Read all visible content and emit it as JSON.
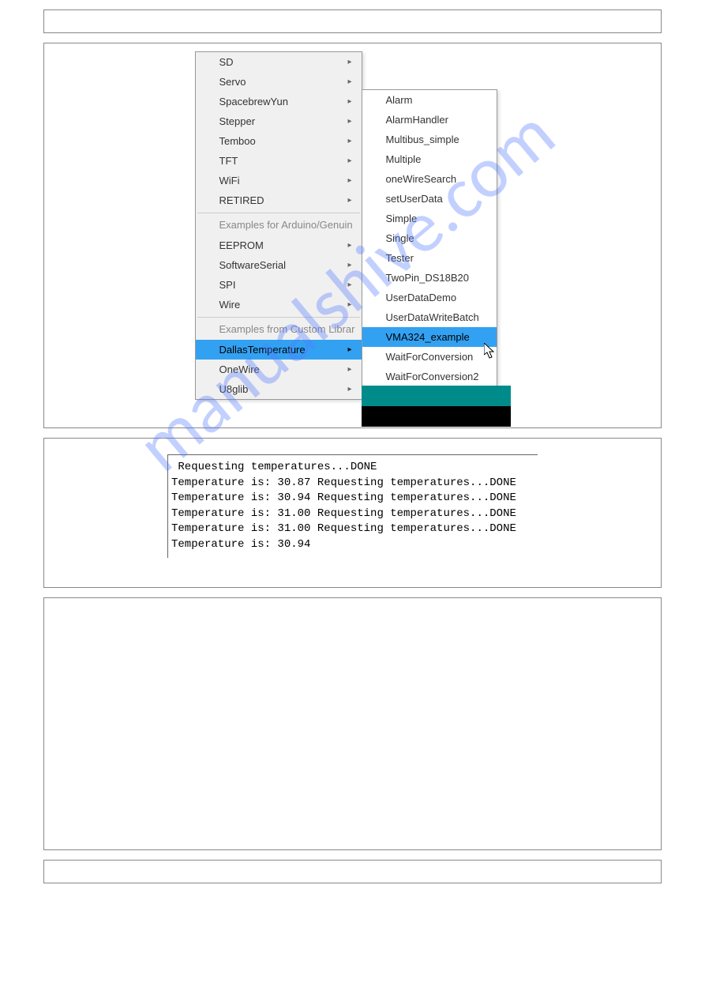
{
  "left_menu": {
    "group1": [
      "SD",
      "Servo",
      "SpacebrewYun",
      "Stepper",
      "Temboo",
      "TFT",
      "WiFi",
      "RETIRED"
    ],
    "header2": "Examples for Arduino/Genuin",
    "group2": [
      "EEPROM",
      "SoftwareSerial",
      "SPI",
      "Wire"
    ],
    "header3": "Examples from Custom Librar",
    "group3": [
      {
        "label": "DallasTemperature",
        "highlighted": true
      },
      {
        "label": "OneWire",
        "highlighted": false
      },
      {
        "label": "U8glib",
        "highlighted": false
      }
    ]
  },
  "right_menu": [
    {
      "label": "Alarm",
      "selected": false
    },
    {
      "label": "AlarmHandler",
      "selected": false
    },
    {
      "label": "Multibus_simple",
      "selected": false
    },
    {
      "label": "Multiple",
      "selected": false
    },
    {
      "label": "oneWireSearch",
      "selected": false
    },
    {
      "label": "setUserData",
      "selected": false
    },
    {
      "label": "Simple",
      "selected": false
    },
    {
      "label": "Single",
      "selected": false
    },
    {
      "label": "Tester",
      "selected": false
    },
    {
      "label": "TwoPin_DS18B20",
      "selected": false
    },
    {
      "label": "UserDataDemo",
      "selected": false
    },
    {
      "label": "UserDataWriteBatch",
      "selected": false
    },
    {
      "label": "VMA324_example",
      "selected": true
    },
    {
      "label": "WaitForConversion",
      "selected": false
    },
    {
      "label": "WaitForConversion2",
      "selected": false
    }
  ],
  "console_output": " Requesting temperatures...DONE\nTemperature is: 30.87 Requesting temperatures...DONE\nTemperature is: 30.94 Requesting temperatures...DONE\nTemperature is: 31.00 Requesting temperatures...DONE\nTemperature is: 31.00 Requesting temperatures...DONE\nTemperature is: 30.94",
  "watermark_text": "manualshive.com"
}
